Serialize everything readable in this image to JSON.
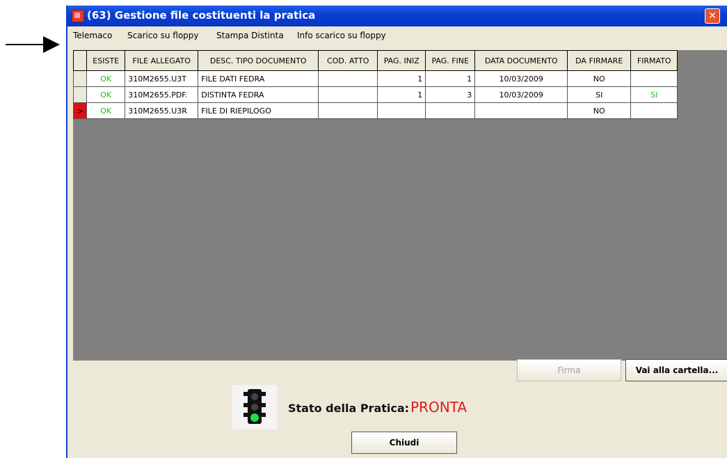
{
  "window": {
    "title": "(63) Gestione file costituenti la pratica",
    "close_symbol": "✕"
  },
  "menu": [
    "Telemaco",
    "Scarico su floppy",
    "Stampa Distinta",
    "Info scarico su floppy"
  ],
  "table": {
    "columns": [
      "ESISTE",
      "FILE ALLEGATO",
      "DESC. TIPO DOCUMENTO",
      "COD. ATTO",
      "PAG. INIZ",
      "PAG. FINE",
      "DATA DOCUMENTO",
      "DA FIRMARE",
      "FIRMATO"
    ],
    "rows": [
      {
        "esiste": "OK",
        "file": "310M2655.U3T",
        "desc": "FILE DATI FEDRA",
        "cod": "",
        "pag_iniz": "1",
        "pag_fine": "1",
        "data": "10/03/2009",
        "da_firmare": "NO",
        "firmato": "",
        "current": false
      },
      {
        "esiste": "OK",
        "file": "310M2655.PDF.",
        "desc": "DISTINTA FEDRA",
        "cod": "",
        "pag_iniz": "1",
        "pag_fine": "3",
        "data": "10/03/2009",
        "da_firmare": "SI",
        "firmato": "SI",
        "current": false
      },
      {
        "esiste": "OK",
        "file": "310M2655.U3R",
        "desc": "FILE DI RIEPILOGO",
        "cod": "",
        "pag_iniz": "",
        "pag_fine": "",
        "data": "",
        "da_firmare": "NO",
        "firmato": "",
        "current": true
      }
    ]
  },
  "buttons": {
    "firma": "Firma",
    "vai_cartella": "Vai alla cartella...",
    "chiudi": "Chiudi"
  },
  "status": {
    "label": "Stato della Pratica:",
    "value": "PRONTA",
    "icon": "traffic-light-green-icon",
    "value_color": "#e01818"
  },
  "colors": {
    "titlebar": "#0a3fd4",
    "ok_green": "#22bb22"
  }
}
